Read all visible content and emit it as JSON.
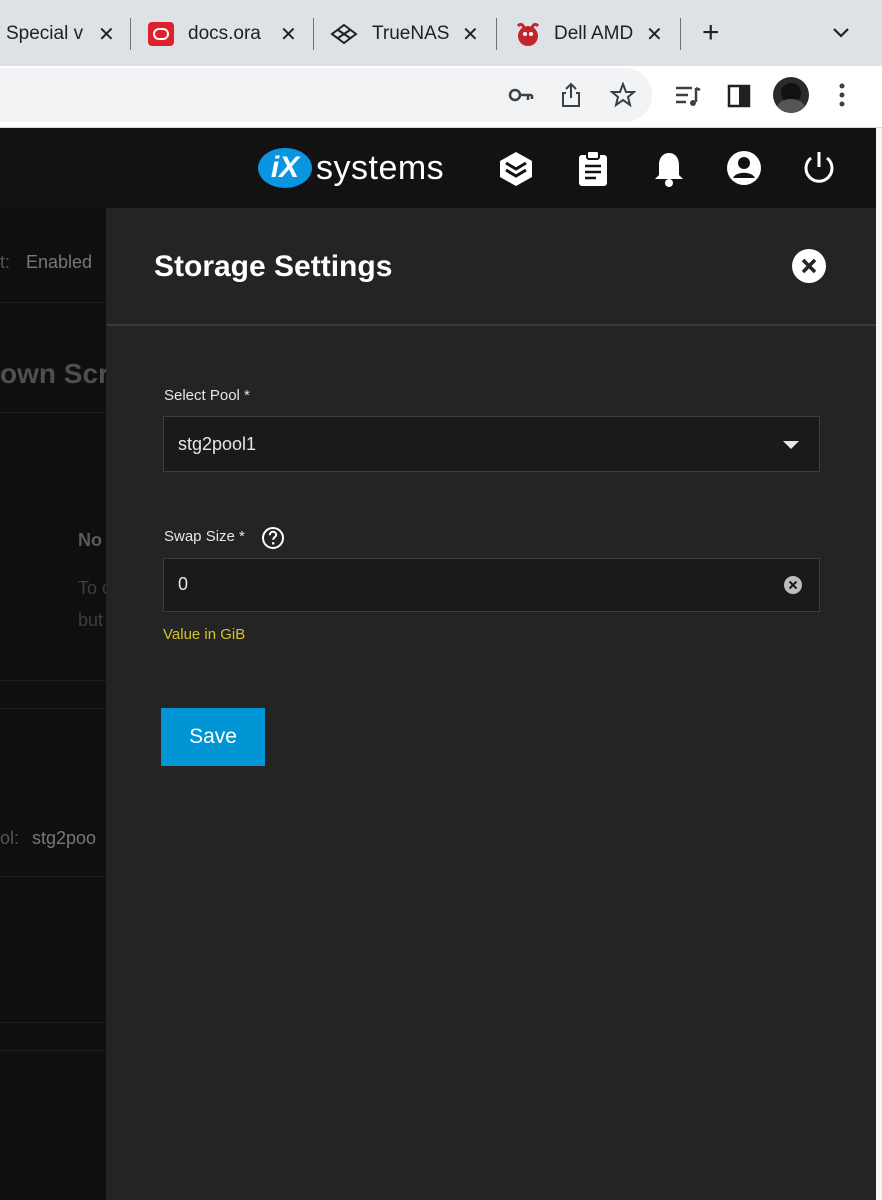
{
  "browser": {
    "tabs": [
      {
        "title": "Special v",
        "close": "✕"
      },
      {
        "title": "docs.ora",
        "close": "✕"
      },
      {
        "title": "TrueNAS",
        "close": "✕"
      },
      {
        "title": "Dell AMD",
        "close": "✕"
      }
    ],
    "new_tab": "+",
    "colors": {
      "oracle": "#e0202f",
      "toolbar_bg": "#dee1e6"
    }
  },
  "header": {
    "logo_badge": "iX",
    "logo_text": "systems"
  },
  "background": {
    "enabled_label": "t:",
    "enabled_value": "Enabled",
    "section_title": "own Scri",
    "no_text": "No",
    "line1": "To c",
    "line2": "but",
    "pool_label": "ol:",
    "pool_value": "stg2poo"
  },
  "panel": {
    "title": "Storage Settings",
    "pool_label": "Select Pool *",
    "pool_value": "stg2pool1",
    "swap_label": "Swap Size *",
    "swap_value": "0",
    "swap_hint": "Value in GiB",
    "save_label": "Save",
    "colors": {
      "accent": "#0095d5",
      "hint": "#d6c22a"
    }
  }
}
